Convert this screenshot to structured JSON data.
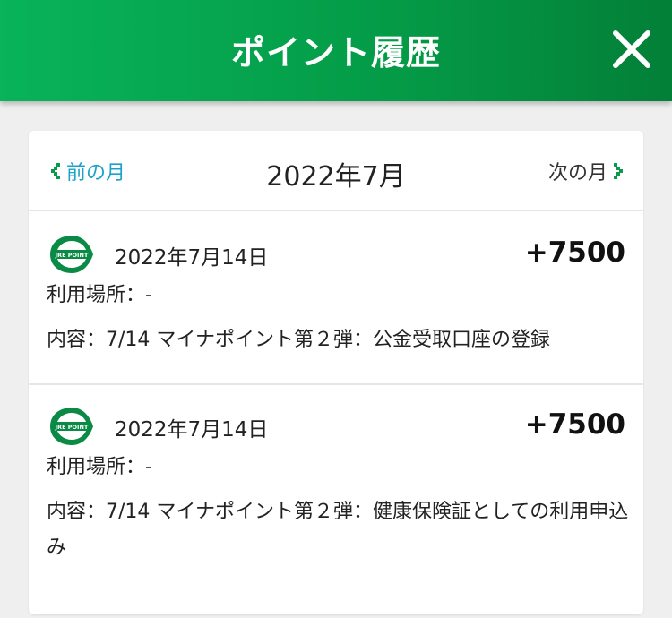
{
  "header": {
    "title": "ポイント履歴",
    "close_icon": "close-icon"
  },
  "nav": {
    "prev_label": "前の月",
    "next_label": "次の月",
    "current_month": "2022年7月",
    "prev_icon": "chevron-left-icon",
    "next_icon": "chevron-right-icon"
  },
  "colors": {
    "header_green": "#049a46",
    "link_blue": "#1aa3c8",
    "nav_arrow_green": "#0a9a4c"
  },
  "entries": [
    {
      "logo_text": "JRE POINT",
      "date": "2022年7月14日",
      "points": "+7500",
      "place": "利用場所：-",
      "content": "内容：7/14 マイナポイント第２弾：公金受取口座の登録"
    },
    {
      "logo_text": "JRE POINT",
      "date": "2022年7月14日",
      "points": "+7500",
      "place": "利用場所：-",
      "content": "内容：7/14 マイナポイント第２弾：健康保険証としての利用申込み"
    }
  ]
}
